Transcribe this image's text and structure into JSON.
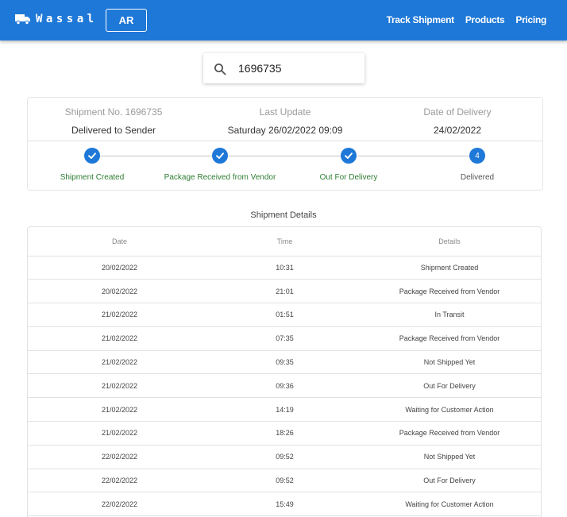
{
  "header": {
    "brand": "Wassal",
    "lang_button": "AR",
    "nav": [
      "Track Shipment",
      "Products",
      "Pricing"
    ],
    "color": "#1e78d7"
  },
  "search": {
    "value": "1696735",
    "icon": "search-icon"
  },
  "summary": {
    "shipment_label": "Shipment No. 1696735",
    "shipment_status": "Delivered to Sender",
    "update_label": "Last Update",
    "update_value": "Saturday 26/02/2022 09:09",
    "delivery_label": "Date of Delivery",
    "delivery_value": "24/02/2022"
  },
  "steps": [
    {
      "label": "Shipment Created",
      "state": "done",
      "icon": "check-icon"
    },
    {
      "label": "Package Received from Vendor",
      "state": "done",
      "icon": "check-icon"
    },
    {
      "label": "Out For Delivery",
      "state": "done",
      "icon": "check-icon"
    },
    {
      "label": "Delivered",
      "state": "current",
      "number": "4"
    }
  ],
  "details": {
    "title": "Shipment Details",
    "columns": [
      "Date",
      "Time",
      "Details"
    ],
    "rows": [
      [
        "20/02/2022",
        "10:31",
        "Shipment Created"
      ],
      [
        "20/02/2022",
        "21:01",
        "Package Received from Vendor"
      ],
      [
        "21/02/2022",
        "01:51",
        "In Transit"
      ],
      [
        "21/02/2022",
        "07:35",
        "Package Received from Vendor"
      ],
      [
        "21/02/2022",
        "09:35",
        "Not Shipped Yet"
      ],
      [
        "21/02/2022",
        "09:36",
        "Out For Delivery"
      ],
      [
        "21/02/2022",
        "14:19",
        "Waiting for Customer Action"
      ],
      [
        "21/02/2022",
        "18:26",
        "Package Received from Vendor"
      ],
      [
        "22/02/2022",
        "09:52",
        "Not Shipped Yet"
      ],
      [
        "22/02/2022",
        "09:52",
        "Out For Delivery"
      ],
      [
        "22/02/2022",
        "15:49",
        "Waiting for Customer Action"
      ]
    ]
  }
}
